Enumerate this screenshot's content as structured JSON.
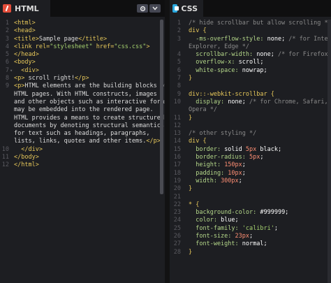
{
  "html_pane": {
    "tab_label": "HTML",
    "lines": [
      {
        "n": "1",
        "fold": "",
        "segs": [
          {
            "c": "tag",
            "t": "<html>"
          }
        ]
      },
      {
        "n": "2",
        "fold": "",
        "segs": [
          {
            "c": "tag",
            "t": "<head>"
          }
        ]
      },
      {
        "n": "3",
        "fold": "",
        "segs": [
          {
            "c": "tag",
            "t": "<title>"
          },
          {
            "c": "plain",
            "t": "Sample page"
          },
          {
            "c": "tag",
            "t": "</title>"
          }
        ]
      },
      {
        "n": "4",
        "fold": "",
        "segs": [
          {
            "c": "tag",
            "t": "<link "
          },
          {
            "c": "attr",
            "t": "rel="
          },
          {
            "c": "str",
            "t": "\"stylesheet\""
          },
          {
            "c": "attr",
            "t": " href="
          },
          {
            "c": "str",
            "t": "\"css.css\""
          },
          {
            "c": "tag",
            "t": ">"
          }
        ]
      },
      {
        "n": "5",
        "fold": "",
        "segs": [
          {
            "c": "tag",
            "t": "</head>"
          }
        ]
      },
      {
        "n": "6",
        "fold": "",
        "segs": [
          {
            "c": "tag",
            "t": "<body>"
          }
        ]
      },
      {
        "n": "7",
        "fold": "▾",
        "segs": [
          {
            "c": "plain",
            "t": "  "
          },
          {
            "c": "tag",
            "t": "<div>"
          }
        ]
      },
      {
        "n": "8",
        "fold": "",
        "segs": [
          {
            "c": "tag",
            "t": "<p>"
          },
          {
            "c": "plain",
            "t": " scroll right!"
          },
          {
            "c": "tag",
            "t": "</p>"
          }
        ]
      },
      {
        "n": "9",
        "fold": "",
        "segs": [
          {
            "c": "tag",
            "t": "<p>"
          },
          {
            "c": "plain",
            "t": "HTML elements are the building blocks of"
          }
        ]
      },
      {
        "n": "",
        "fold": "",
        "segs": [
          {
            "c": "plain",
            "t": "HTML pages. With HTML constructs, images"
          }
        ]
      },
      {
        "n": "",
        "fold": "",
        "segs": [
          {
            "c": "plain",
            "t": "and other objects such as interactive forms"
          }
        ]
      },
      {
        "n": "",
        "fold": "",
        "segs": [
          {
            "c": "plain",
            "t": "may be embedded into the rendered page."
          }
        ]
      },
      {
        "n": "",
        "fold": "",
        "segs": [
          {
            "c": "plain",
            "t": "HTML provides a means to create structured"
          }
        ]
      },
      {
        "n": "",
        "fold": "",
        "segs": [
          {
            "c": "plain",
            "t": "documents by denoting structural semantics"
          }
        ]
      },
      {
        "n": "",
        "fold": "",
        "segs": [
          {
            "c": "plain",
            "t": "for text such as headings, paragraphs,"
          }
        ]
      },
      {
        "n": "",
        "fold": "",
        "segs": [
          {
            "c": "plain",
            "t": "lists, links, quotes and other items."
          },
          {
            "c": "tag",
            "t": "</p>"
          }
        ]
      },
      {
        "n": "10",
        "fold": "",
        "segs": [
          {
            "c": "plain",
            "t": "  "
          },
          {
            "c": "tag",
            "t": "</div>"
          }
        ]
      },
      {
        "n": "11",
        "fold": "",
        "segs": [
          {
            "c": "tag",
            "t": "</body>"
          }
        ]
      },
      {
        "n": "12",
        "fold": "",
        "segs": [
          {
            "c": "tag",
            "t": "</html>"
          }
        ]
      }
    ]
  },
  "css_pane": {
    "tab_label": "CSS",
    "lines": [
      {
        "n": "1",
        "fold": "",
        "segs": [
          {
            "c": "comment",
            "t": "/* hide scrollbar but allow scrolling */"
          }
        ]
      },
      {
        "n": "2",
        "fold": "",
        "segs": [
          {
            "c": "sel",
            "t": "div {"
          }
        ]
      },
      {
        "n": "3",
        "fold": "",
        "segs": [
          {
            "c": "prop",
            "t": "  -ms-overflow-style: "
          },
          {
            "c": "val",
            "t": "none;"
          },
          {
            "c": "comment",
            "t": " /* for Internet"
          }
        ]
      },
      {
        "n": "",
        "fold": "",
        "segs": [
          {
            "c": "comment",
            "t": "Explorer, Edge */"
          }
        ]
      },
      {
        "n": "4",
        "fold": "",
        "segs": [
          {
            "c": "prop",
            "t": "  scrollbar-width: "
          },
          {
            "c": "val",
            "t": "none;"
          },
          {
            "c": "comment",
            "t": " /* for Firefox */"
          }
        ]
      },
      {
        "n": "5",
        "fold": "",
        "segs": [
          {
            "c": "prop",
            "t": "  overflow-x: "
          },
          {
            "c": "val",
            "t": "scroll;"
          }
        ]
      },
      {
        "n": "6",
        "fold": "",
        "segs": [
          {
            "c": "prop",
            "t": "  white-space: "
          },
          {
            "c": "val",
            "t": "nowrap;"
          }
        ]
      },
      {
        "n": "7",
        "fold": "",
        "segs": [
          {
            "c": "sel",
            "t": "}"
          }
        ]
      },
      {
        "n": "8",
        "fold": "",
        "segs": []
      },
      {
        "n": "9",
        "fold": "",
        "segs": [
          {
            "c": "sel",
            "t": "div::-webkit-scrollbar {"
          }
        ]
      },
      {
        "n": "10",
        "fold": "",
        "segs": [
          {
            "c": "prop",
            "t": "  display: "
          },
          {
            "c": "val",
            "t": "none;"
          },
          {
            "c": "comment",
            "t": " /* for Chrome, Safari, and"
          }
        ]
      },
      {
        "n": "",
        "fold": "",
        "segs": [
          {
            "c": "comment",
            "t": "Opera */"
          }
        ]
      },
      {
        "n": "11",
        "fold": "",
        "segs": [
          {
            "c": "sel",
            "t": "}"
          }
        ]
      },
      {
        "n": "12",
        "fold": "",
        "segs": []
      },
      {
        "n": "13",
        "fold": "",
        "segs": [
          {
            "c": "comment",
            "t": "/* other styling */"
          }
        ]
      },
      {
        "n": "14",
        "fold": "",
        "segs": [
          {
            "c": "sel",
            "t": "div {"
          }
        ]
      },
      {
        "n": "15",
        "fold": "",
        "segs": [
          {
            "c": "prop",
            "t": "  border: "
          },
          {
            "c": "val",
            "t": "solid "
          },
          {
            "c": "num",
            "t": "5px"
          },
          {
            "c": "val",
            "t": " black;"
          }
        ]
      },
      {
        "n": "16",
        "fold": "",
        "segs": [
          {
            "c": "prop",
            "t": "  border-radius: "
          },
          {
            "c": "num",
            "t": "5px"
          },
          {
            "c": "val",
            "t": ";"
          }
        ]
      },
      {
        "n": "17",
        "fold": "",
        "segs": [
          {
            "c": "prop",
            "t": "  height: "
          },
          {
            "c": "num",
            "t": "150px"
          },
          {
            "c": "val",
            "t": ";"
          }
        ]
      },
      {
        "n": "18",
        "fold": "",
        "segs": [
          {
            "c": "prop",
            "t": "  padding: "
          },
          {
            "c": "num",
            "t": "10px"
          },
          {
            "c": "val",
            "t": ";"
          }
        ]
      },
      {
        "n": "19",
        "fold": "",
        "segs": [
          {
            "c": "prop",
            "t": "  width: "
          },
          {
            "c": "num",
            "t": "300px"
          },
          {
            "c": "val",
            "t": ";"
          }
        ]
      },
      {
        "n": "20",
        "fold": "",
        "segs": [
          {
            "c": "sel",
            "t": "}"
          }
        ]
      },
      {
        "n": "21",
        "fold": "",
        "segs": []
      },
      {
        "n": "22",
        "fold": "",
        "segs": [
          {
            "c": "sel",
            "t": "* {"
          }
        ]
      },
      {
        "n": "23",
        "fold": "",
        "segs": [
          {
            "c": "prop",
            "t": "  background-color: "
          },
          {
            "c": "val",
            "t": "#999999;"
          }
        ]
      },
      {
        "n": "24",
        "fold": "",
        "segs": [
          {
            "c": "prop",
            "t": "  color: "
          },
          {
            "c": "val",
            "t": "blue;"
          }
        ]
      },
      {
        "n": "25",
        "fold": "",
        "segs": [
          {
            "c": "prop",
            "t": "  font-family: "
          },
          {
            "c": "str",
            "t": "'calibri'"
          },
          {
            "c": "val",
            "t": ";"
          }
        ]
      },
      {
        "n": "26",
        "fold": "",
        "segs": [
          {
            "c": "prop",
            "t": "  font-size: "
          },
          {
            "c": "num",
            "t": "23px"
          },
          {
            "c": "val",
            "t": ";"
          }
        ]
      },
      {
        "n": "27",
        "fold": "",
        "segs": [
          {
            "c": "prop",
            "t": "  font-weight: "
          },
          {
            "c": "val",
            "t": "normal;"
          }
        ]
      },
      {
        "n": "28",
        "fold": "",
        "segs": [
          {
            "c": "sel",
            "t": "}"
          }
        ]
      }
    ]
  },
  "icons": {
    "settings": "gear-icon",
    "collapse": "chevron-down-icon"
  }
}
